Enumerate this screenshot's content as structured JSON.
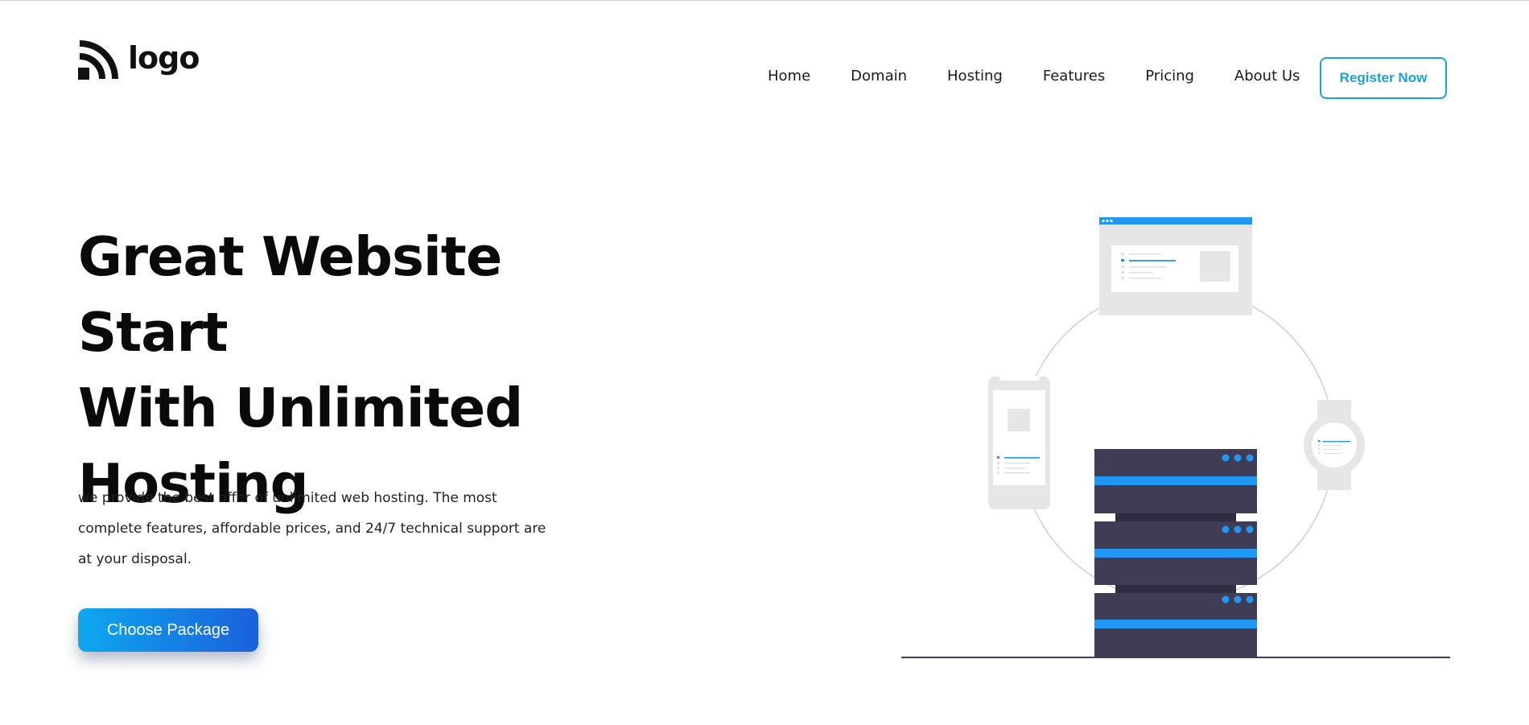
{
  "header": {
    "logo_text": "logo",
    "nav": [
      {
        "label": "Home"
      },
      {
        "label": "Domain"
      },
      {
        "label": "Hosting"
      },
      {
        "label": "Features"
      },
      {
        "label": "Pricing"
      },
      {
        "label": "About Us"
      }
    ],
    "register_label": "Register Now"
  },
  "hero": {
    "title_line1": "Great Website Start",
    "title_line2": "With Unlimited",
    "title_line3": "Hosting",
    "description": "we provide the best offer of unlimited web hosting. The most complete features, affordable prices, and 24/7 technical support are at your disposal.",
    "cta_label": "Choose Package"
  },
  "colors": {
    "accent": "#1aa1dc",
    "gradient_start": "#0ea8ef",
    "gradient_end": "#1b60dc",
    "server": "#3f3d56",
    "server_stripe": "#2196f3"
  },
  "icons": {
    "logo": "signal-waves-icon",
    "illustration": "hosting-servers-devices-illustration"
  }
}
